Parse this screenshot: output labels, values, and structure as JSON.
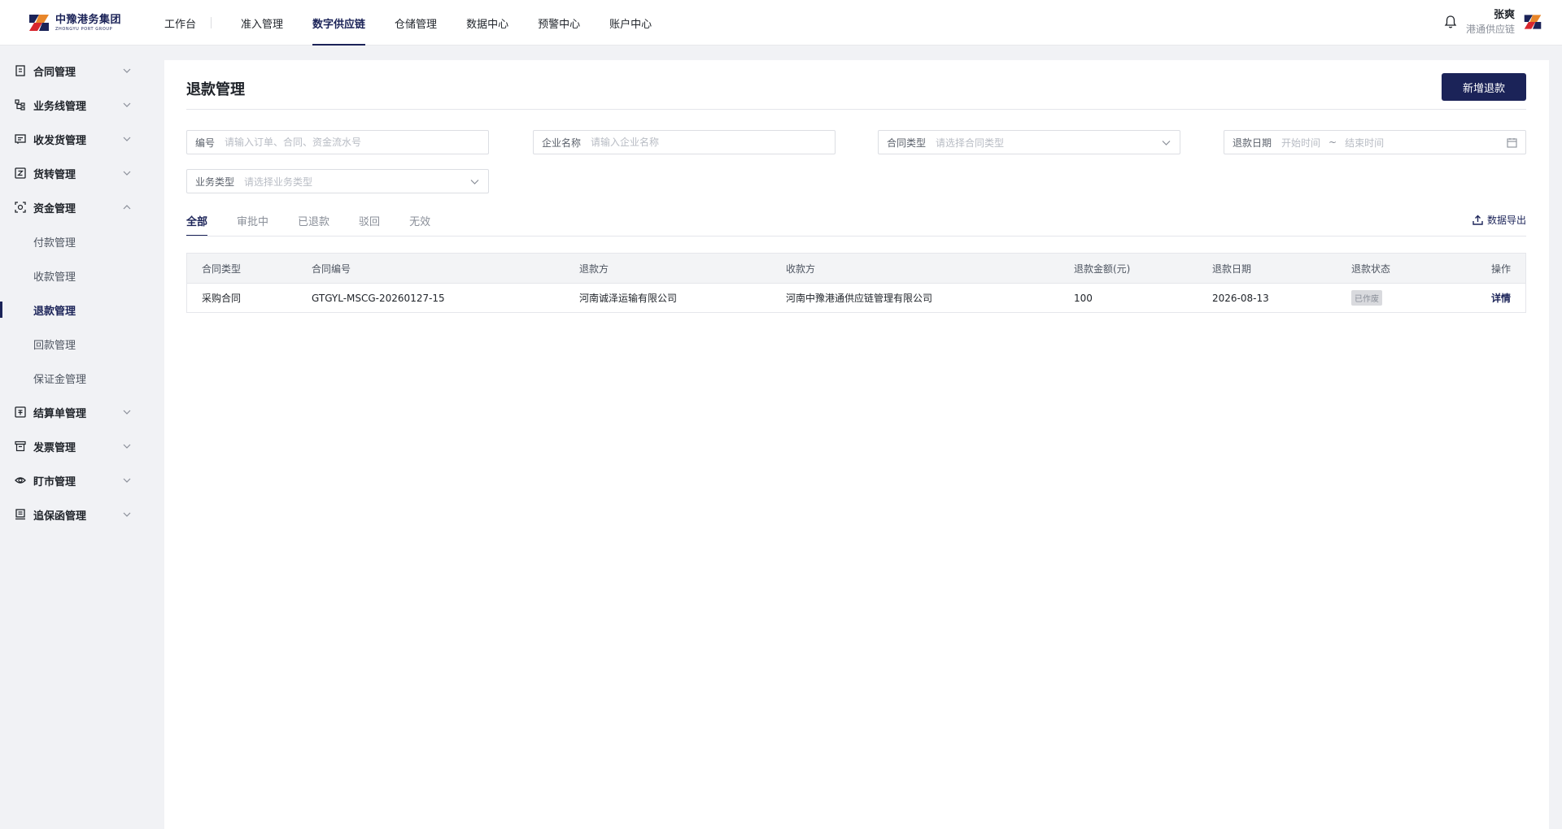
{
  "header": {
    "logo_cn": "中豫港务集团",
    "logo_en": "ZHONGYU PORT GROUP",
    "nav": [
      "工作台",
      "准入管理",
      "数字供应链",
      "仓储管理",
      "数据中心",
      "预警中心",
      "账户中心"
    ],
    "active_nav": "数字供应链",
    "user_name": "张爽",
    "user_org": "港通供应链"
  },
  "sidebar": {
    "groups": [
      {
        "label": "合同管理",
        "icon": "contract-icon"
      },
      {
        "label": "业务线管理",
        "icon": "tree-icon"
      },
      {
        "label": "收发货管理",
        "icon": "delivery-icon"
      },
      {
        "label": "货转管理",
        "icon": "transfer-icon"
      },
      {
        "label": "资金管理",
        "icon": "fund-icon",
        "expanded": true,
        "children": [
          "付款管理",
          "收款管理",
          "退款管理",
          "回款管理",
          "保证金管理"
        ],
        "active_child": "退款管理"
      },
      {
        "label": "结算单管理",
        "icon": "settlement-icon"
      },
      {
        "label": "发票管理",
        "icon": "invoice-icon"
      },
      {
        "label": "盯市管理",
        "icon": "eye-icon"
      },
      {
        "label": "追保函管理",
        "icon": "guarantee-icon"
      }
    ]
  },
  "page": {
    "title": "退款管理",
    "add_button": "新增退款",
    "filters": {
      "code_label": "编号",
      "code_placeholder": "请输入订单、合同、资金流水号",
      "company_label": "企业名称",
      "company_placeholder": "请输入企业名称",
      "contract_type_label": "合同类型",
      "contract_type_placeholder": "请选择合同类型",
      "refund_date_label": "退款日期",
      "start_placeholder": "开始时间",
      "tilde": "~",
      "end_placeholder": "结束时间",
      "biz_type_label": "业务类型",
      "biz_type_placeholder": "请选择业务类型"
    },
    "tabs": [
      "全部",
      "审批中",
      "已退款",
      "驳回",
      "无效"
    ],
    "active_tab": "全部",
    "export_label": "数据导出",
    "table": {
      "columns": [
        "合同类型",
        "合同编号",
        "退款方",
        "收款方",
        "退款金额(元)",
        "退款日期",
        "退款状态",
        "操作"
      ],
      "rows": [
        [
          "采购合同",
          "GTGYL-MSCG-20260127-15",
          "河南诚泽运输有限公司",
          "河南中豫港通供应链管理有限公司",
          "100",
          "2026-08-13",
          "已作废",
          "详情"
        ]
      ]
    }
  },
  "colors": {
    "brand": "#1b2358",
    "accent_orange": "#e8862a",
    "accent_red": "#d8262d"
  }
}
